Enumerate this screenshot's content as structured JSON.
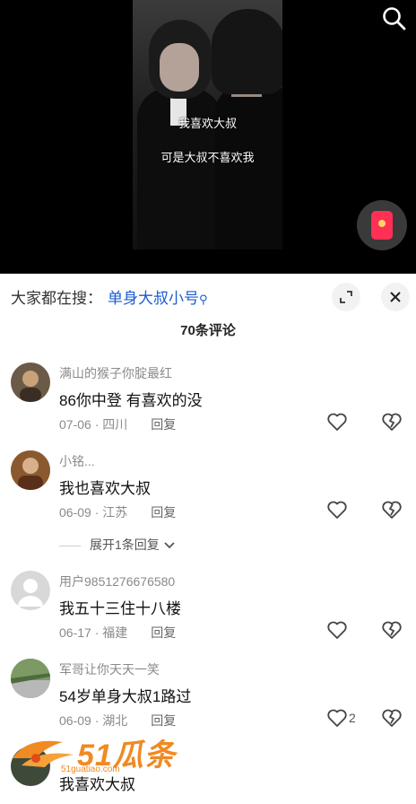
{
  "video": {
    "captions": [
      "我喜欢大叔",
      "可是大叔不喜欢我"
    ]
  },
  "search": {
    "prefix": "大家都在搜：",
    "keyword": "单身大叔小号"
  },
  "comment_count_label": "70条评论",
  "comments": [
    {
      "username": "满山的猴子你腚最红",
      "text": "86你中登  有喜欢的没",
      "date": "07-06",
      "location": "四川",
      "reply": "回复",
      "likes": ""
    },
    {
      "username": "小铭...",
      "text": "我也喜欢大叔",
      "date": "06-09",
      "location": "江苏",
      "reply": "回复",
      "likes": ""
    },
    {
      "username": "用户9851276676580",
      "text": "我五十三住十八楼",
      "date": "06-17",
      "location": "福建",
      "reply": "回复",
      "likes": ""
    },
    {
      "username": "军哥让你天天一笑",
      "text": "54岁单身大叔1路过",
      "date": "06-09",
      "location": "湖北",
      "reply": "回复",
      "likes": "2"
    },
    {
      "username": "",
      "text": "我喜欢大叔",
      "date": "",
      "location": "",
      "reply": "",
      "likes": ""
    }
  ],
  "expand_replies": "展开1条回复",
  "watermark": {
    "text": "51瓜条",
    "url": "51guatiao.com"
  },
  "colors": {
    "keyword": "#1b5bd0",
    "redpack": "#ff2f55",
    "watermark": "#f08a22"
  }
}
